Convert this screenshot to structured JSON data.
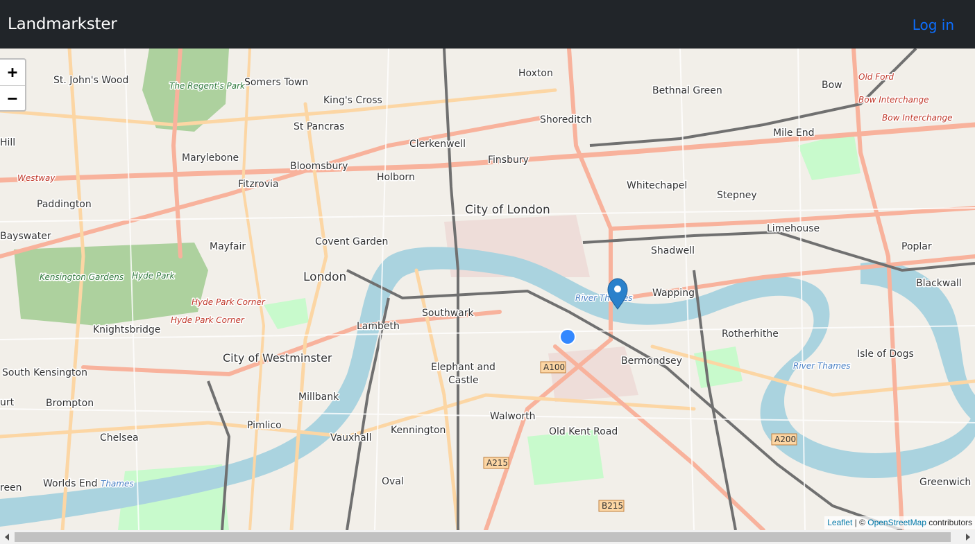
{
  "navbar": {
    "brand": "Landmarkster",
    "login_label": "Log in"
  },
  "map": {
    "zoom_in": "+",
    "zoom_out": "−",
    "labels": [
      "St. John's Wood",
      "Somers Town",
      "Hoxton",
      "Bethnal Green",
      "Bow",
      "King's Cross",
      "St Pancras",
      "Shoreditch",
      "Mile End",
      "Marylebone",
      "Clerkenwell",
      "Finsbury",
      "Bloomsbury",
      "Holborn",
      "Fitzrovia",
      "Whitechapel",
      "Paddington",
      "City of London",
      "Stepney",
      "Limehouse",
      "Bayswater",
      "Mayfair",
      "Covent Garden",
      "Shadwell",
      "Poplar",
      "London",
      "Wapping",
      "Blackwall",
      "Southwark",
      "Lambeth",
      "Knightsbridge",
      "Rotherhithe",
      "City of Westminster",
      "Bermondsey",
      "Isle of Dogs",
      "Elephant and",
      "Castle",
      "South Kensington",
      "Brompton",
      "Millbank",
      "Walworth",
      "Pimlico",
      "Kennington",
      "Old Kent Road",
      "Chelsea",
      "Vauxhall",
      "Oval",
      "Worlds End",
      "Greenwich",
      "Hill",
      "urt",
      "reen"
    ],
    "park_labels": [
      "The Regent's Park",
      "Kensington Gardens",
      "Hyde Park"
    ],
    "red_labels": [
      "Hyde Park Corner",
      "Hyde Park Corner",
      "Old Ford",
      "Bow Interchange",
      "Bow Interchange",
      "Westway"
    ],
    "water_labels": [
      "River Thames",
      "River Thames",
      "Thames"
    ],
    "shields": [
      "A100",
      "A215",
      "A200",
      "B215"
    ],
    "attribution": {
      "leaflet": "Leaflet",
      "sep": " | © ",
      "osm": "OpenStreetMap",
      "suffix": " contributors"
    }
  }
}
